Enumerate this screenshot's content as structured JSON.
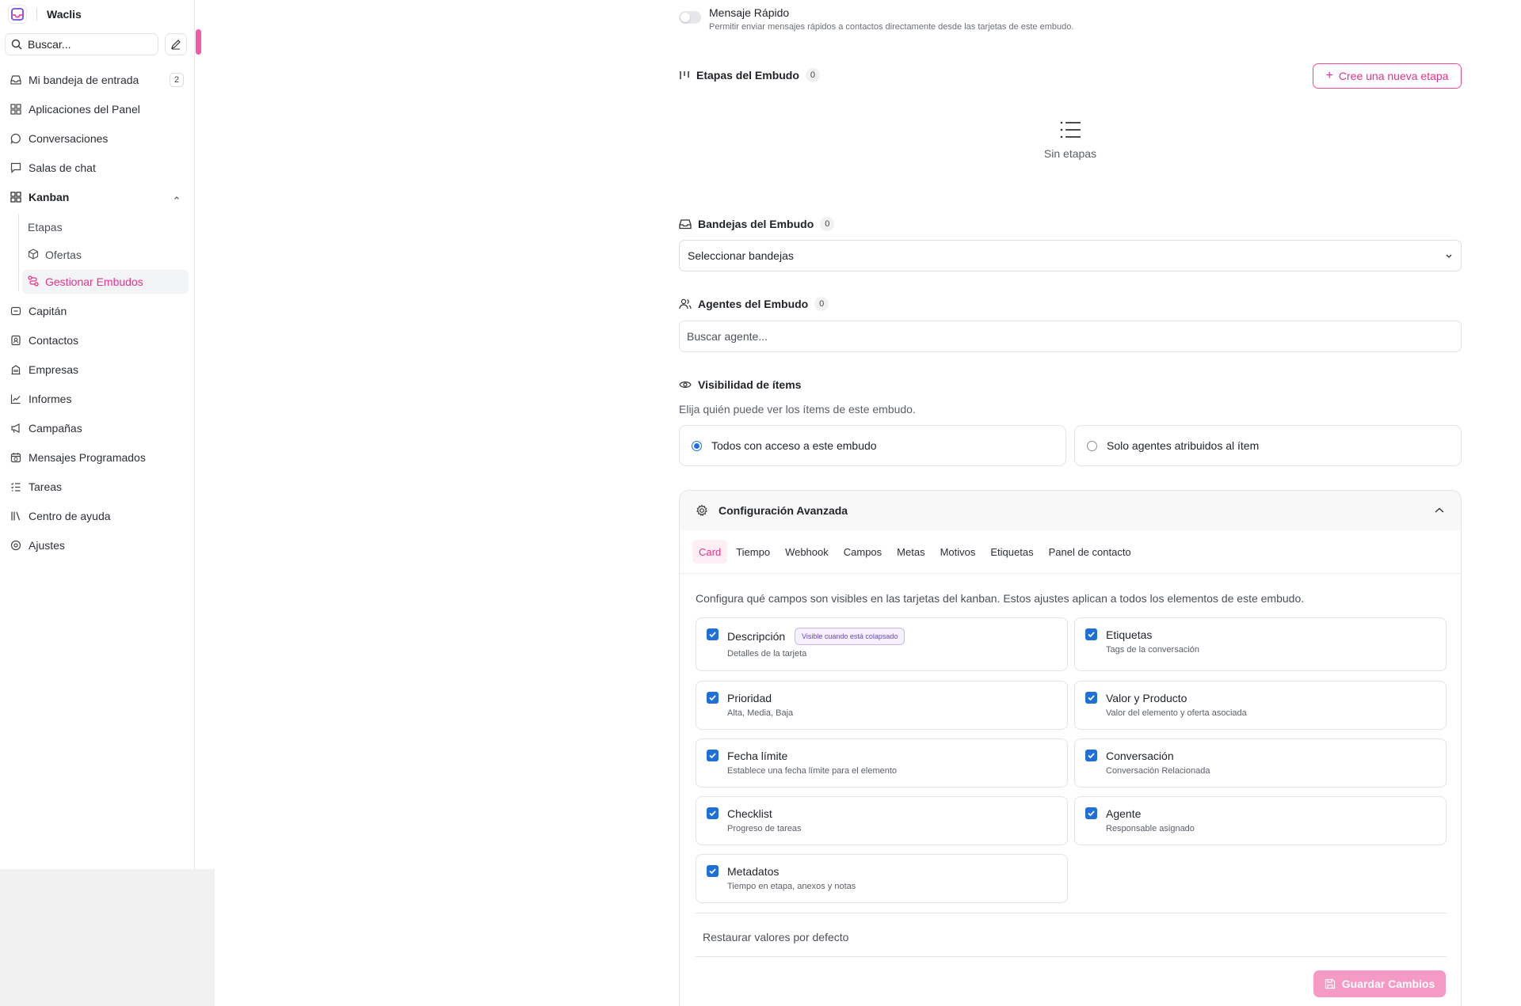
{
  "app": {
    "name": "Waclis"
  },
  "sidebar": {
    "search_placeholder": "Buscar...",
    "items": [
      {
        "label": "Mi bandeja de entrada",
        "badge": "2"
      },
      {
        "label": "Aplicaciones del Panel"
      },
      {
        "label": "Conversaciones"
      },
      {
        "label": "Salas de chat"
      },
      {
        "label": "Kanban"
      },
      {
        "label": "Capitán"
      },
      {
        "label": "Contactos"
      },
      {
        "label": "Empresas"
      },
      {
        "label": "Informes"
      },
      {
        "label": "Campañas"
      },
      {
        "label": "Mensajes Programados"
      },
      {
        "label": "Tareas"
      },
      {
        "label": "Centro de ayuda"
      },
      {
        "label": "Ajustes"
      }
    ],
    "kanban_sub": [
      {
        "label": "Etapas"
      },
      {
        "label": "Ofertas"
      },
      {
        "label": "Gestionar Embudos",
        "active": true
      }
    ]
  },
  "main": {
    "quick_message": {
      "title": "Mensaje Rápido",
      "description": "Permitir enviar mensajes rápidos a contactos directamente desde las tarjetas de este embudo.",
      "enabled": false
    },
    "stages": {
      "title": "Etapas del Embudo",
      "count": "0",
      "new_button": "Cree una nueva etapa",
      "empty_text": "Sin etapas"
    },
    "inboxes": {
      "title": "Bandejas del Embudo",
      "count": "0",
      "select_label": "Seleccionar bandejas"
    },
    "agents": {
      "title": "Agentes del Embudo",
      "count": "0",
      "search_placeholder": "Buscar agente..."
    },
    "visibility": {
      "title": "Visibilidad de ítems",
      "description": "Elija quién puede ver los ítems de este embudo.",
      "options": [
        {
          "label": "Todos con acceso a este embudo",
          "selected": true
        },
        {
          "label": "Solo agentes atribuidos al ítem",
          "selected": false
        }
      ]
    },
    "advanced": {
      "title": "Configuración Avanzada",
      "tabs": [
        "Card",
        "Tiempo",
        "Webhook",
        "Campos",
        "Metas",
        "Motivos",
        "Etiquetas",
        "Panel de contacto"
      ],
      "active_tab": "Card",
      "card_description": "Configura qué campos son visibles en las tarjetas del kanban. Estos ajustes aplican a todos los elementos de este embudo.",
      "options": [
        {
          "title": "Descripción",
          "subtitle": "Detalles de la tarjeta",
          "checked": true,
          "badge": "Visible cuando está colapsado"
        },
        {
          "title": "Etiquetas",
          "subtitle": "Tags de la conversación",
          "checked": true
        },
        {
          "title": "Prioridad",
          "subtitle": "Alta, Media, Baja",
          "checked": true
        },
        {
          "title": "Valor y Producto",
          "subtitle": "Valor del elemento y oferta asociada",
          "checked": true
        },
        {
          "title": "Fecha límite",
          "subtitle": "Establece una fecha límite para el elemento",
          "checked": true
        },
        {
          "title": "Conversación",
          "subtitle": "Conversación Relacionada",
          "checked": true
        },
        {
          "title": "Checklist",
          "subtitle": "Progreso de tareas",
          "checked": true
        },
        {
          "title": "Agente",
          "subtitle": "Responsable asignado",
          "checked": true
        },
        {
          "title": "Metadatos",
          "subtitle": "Tiempo en etapa, anexos y notas",
          "checked": true
        }
      ],
      "restore_label": "Restaurar valores por defecto",
      "save_label": "Guardar Cambios"
    }
  },
  "colors": {
    "accent": "#e6338c",
    "checkbox": "#1f6fd8",
    "save_disabled": "#f49ac4"
  }
}
